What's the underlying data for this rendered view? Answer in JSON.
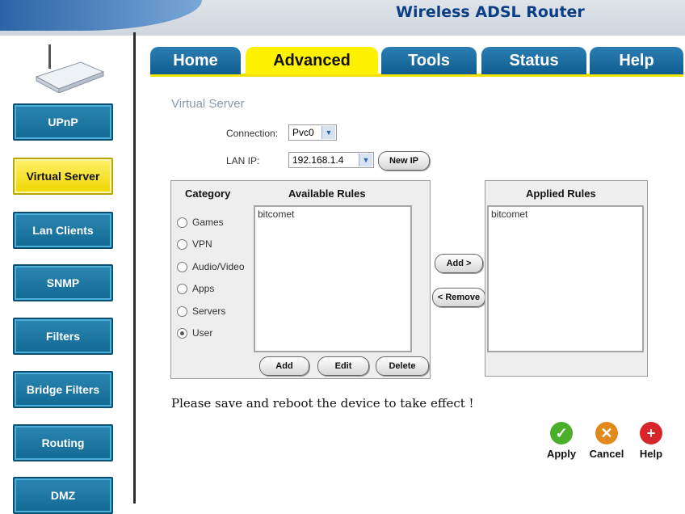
{
  "header": {
    "title": "Wireless ADSL Router"
  },
  "sidebar": {
    "items": [
      {
        "label": "UPnP"
      },
      {
        "label": "Virtual Server"
      },
      {
        "label": "Lan Clients"
      },
      {
        "label": "SNMP"
      },
      {
        "label": "Filters"
      },
      {
        "label": "Bridge Filters"
      },
      {
        "label": "Routing"
      },
      {
        "label": "DMZ"
      }
    ],
    "active": "Virtual Server"
  },
  "tabs": [
    {
      "label": "Home"
    },
    {
      "label": "Advanced"
    },
    {
      "label": "Tools"
    },
    {
      "label": "Status"
    },
    {
      "label": "Help"
    }
  ],
  "page": {
    "section_title": "Virtual Server",
    "connection_label": "Connection:",
    "connection_value": "Pvc0",
    "lan_ip_label": "LAN IP:",
    "lan_ip_value": "192.168.1.4",
    "new_ip_label": "New IP",
    "category_header": "Category",
    "available_header": "Available Rules",
    "applied_header": "Applied Rules",
    "categories": [
      {
        "label": "Games",
        "selected": false
      },
      {
        "label": "VPN",
        "selected": false
      },
      {
        "label": "Audio/Video",
        "selected": false
      },
      {
        "label": "Apps",
        "selected": false
      },
      {
        "label": "Servers",
        "selected": false
      },
      {
        "label": "User",
        "selected": true
      }
    ],
    "available_rules": [
      "bitcomet"
    ],
    "applied_rules": [
      "bitcomet"
    ],
    "add_arrow_label": "Add >",
    "remove_label": "< Remove",
    "add_label": "Add",
    "edit_label": "Edit",
    "delete_label": "Delete",
    "notice": "Please save and reboot the device to take effect !"
  },
  "actions": [
    {
      "label": "Apply",
      "icon": "check-icon",
      "color": "#4caf2a"
    },
    {
      "label": "Cancel",
      "icon": "cancel-icon",
      "color": "#e08a1e"
    },
    {
      "label": "Help",
      "icon": "plus-help-icon",
      "color": "#d6262b"
    }
  ],
  "colors": {
    "accent_blue": "#136a93",
    "active_yellow": "#fff200",
    "header_blue": "#0a3f86"
  }
}
